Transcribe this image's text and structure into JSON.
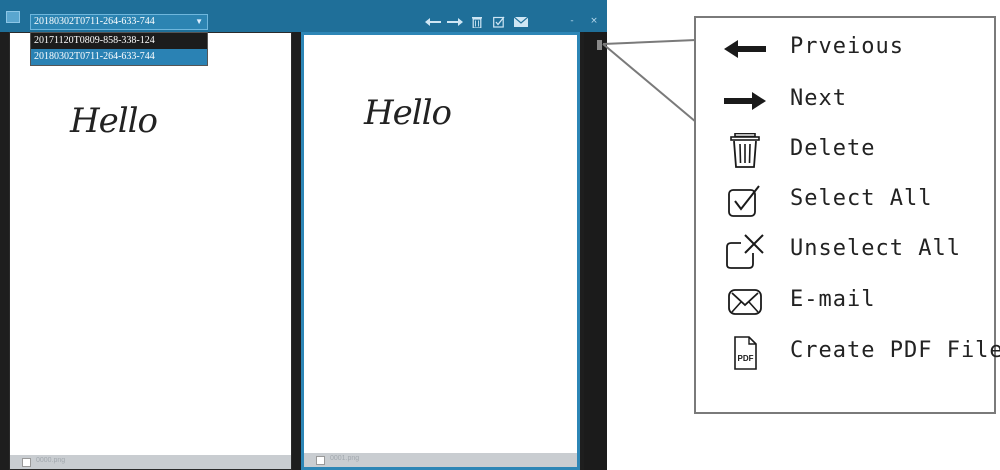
{
  "window": {
    "selected_file": "20180302T0711-264-633-744",
    "dropdown_options": [
      "20171120T0809-858-338-124",
      "20180302T0711-264-633-744"
    ],
    "window_controls": [
      "-",
      "×"
    ]
  },
  "pages": [
    {
      "handwriting": "Hello",
      "footer_label": "0000.png"
    },
    {
      "handwriting": "Hello",
      "footer_label": "0001.png"
    }
  ],
  "legend": {
    "items": [
      {
        "icon": "arrow-left-icon",
        "label": "Prveious"
      },
      {
        "icon": "arrow-right-icon",
        "label": "Next"
      },
      {
        "icon": "trash-icon",
        "label": "Delete"
      },
      {
        "icon": "checkbox-checked-icon",
        "label": "Select All"
      },
      {
        "icon": "checkbox-x-icon",
        "label": "Unselect All"
      },
      {
        "icon": "envelope-icon",
        "label": "E-mail"
      },
      {
        "icon": "pdf-file-icon",
        "label": "Create PDF File"
      }
    ]
  },
  "colors": {
    "titlebar": "#1f6f99",
    "selected_accent": "#2d86b6",
    "legend_border": "#7a7a7a"
  }
}
